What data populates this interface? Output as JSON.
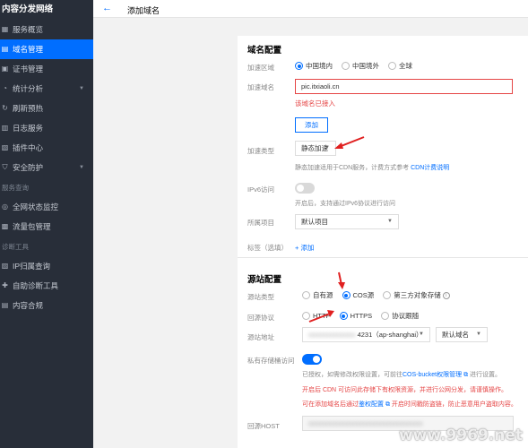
{
  "sidebar": {
    "brand": "内容分发网络",
    "items": [
      {
        "label": "服务概览",
        "icon": "overview-icon"
      },
      {
        "label": "域名管理",
        "icon": "domain-icon",
        "active": true
      },
      {
        "label": "证书管理",
        "icon": "certificate-icon"
      },
      {
        "label": "统计分析",
        "icon": "stats-icon",
        "expandable": true
      },
      {
        "label": "刷新预热",
        "icon": "refresh-icon"
      },
      {
        "label": "日志服务",
        "icon": "log-icon"
      },
      {
        "label": "插件中心",
        "icon": "plugin-icon"
      },
      {
        "label": "安全防护",
        "icon": "shield-icon",
        "expandable": true
      }
    ],
    "section_query": "服务查询",
    "query_items": [
      {
        "label": "全网状态监控",
        "icon": "monitor-icon"
      },
      {
        "label": "流量包管理",
        "icon": "package-icon"
      }
    ],
    "section_tools": "诊断工具",
    "tool_items": [
      {
        "label": "IP归属查询",
        "icon": "ip-icon"
      },
      {
        "label": "自助诊断工具",
        "icon": "diagnose-icon"
      },
      {
        "label": "内容合规",
        "icon": "compliance-icon"
      }
    ]
  },
  "topbar": {
    "back_symbol": "←",
    "title": "添加域名"
  },
  "domain_config": {
    "title": "域名配置",
    "region_label": "加速区域",
    "region_options": [
      "中国境内",
      "中国境外",
      "全球"
    ],
    "region_selected": 0,
    "domain_label": "加速域名",
    "domain_value": "pic.itxiaoli.cn",
    "domain_error": "该域名已接入",
    "add_button": "添加",
    "type_label": "加速类型",
    "type_value": "静态加速",
    "type_hint": "静态加速适用于CDN服务，计费方式参考",
    "type_hint_link": "CDN计费说明",
    "ipv6_label": "IPv6访问",
    "ipv6_on": false,
    "ipv6_hint": "开启后，支持通过IPv6协议进行访问",
    "project_label": "所属项目",
    "project_value": "默认项目",
    "tag_label": "标签（选填）",
    "tag_add": "+ 添加"
  },
  "origin_config": {
    "title": "源站配置",
    "origin_type_label": "源站类型",
    "origin_type_options": [
      "自有源",
      "COS源",
      "第三方对象存储"
    ],
    "origin_type_selected": 1,
    "protocol_label": "回源协议",
    "protocol_options": [
      "HTTP",
      "HTTPS",
      "协议跟随"
    ],
    "protocol_selected": 1,
    "address_label": "源站地址",
    "address_value": "4231（ap-shanghai）",
    "address_blurred": "xxxxxxxxxxxxxx",
    "address_domain_select": "默认域名",
    "private_label": "私有存储桶访问",
    "private_on": true,
    "private_hint": "已授权，如需修改权限设置，可前往",
    "private_hint_link": "COS-bucket权限管理",
    "private_hint_tail": "进行设置。",
    "warn1": "开启后 CDN 可访问此存储下有权限资源，并进行公网分发，请谨慎操作。",
    "warn2_prefix": "可在添加域名后通过",
    "warn2_link": "鉴权配置",
    "warn2_tail": "开启时间戳防盗链，防止恶意用户盗取内容。",
    "host_label": "回源HOST",
    "host_blurred": "xxxxxxxxxxxxxxxxxxxxxxxxxxxxxxxxxx"
  },
  "watermark": "www.9969.net",
  "colors": {
    "accent": "#006eff",
    "error": "#e54545",
    "sidebar_bg": "#282e39"
  }
}
